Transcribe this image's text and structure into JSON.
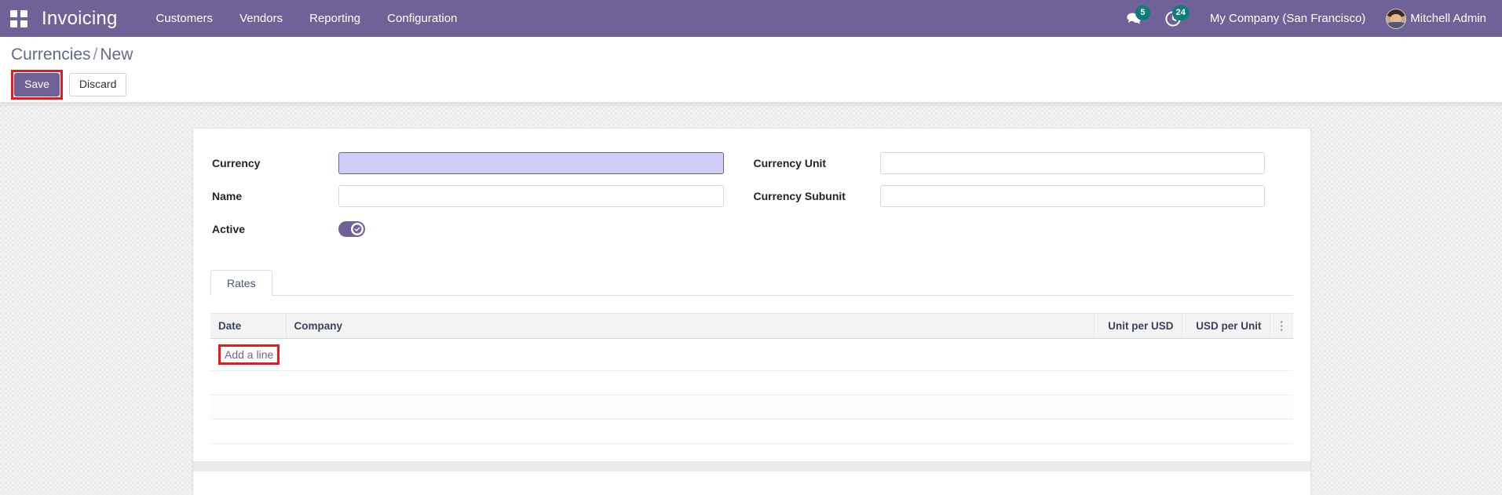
{
  "navbar": {
    "apps_icon": "apps-grid-icon",
    "brand": "Invoicing",
    "menu": [
      {
        "label": "Customers"
      },
      {
        "label": "Vendors"
      },
      {
        "label": "Reporting"
      },
      {
        "label": "Configuration"
      }
    ],
    "messages_icon": "messages-icon",
    "messages_count": "5",
    "activities_icon": "activity-clock-icon",
    "activities_count": "24",
    "company": "My Company (San Francisco)",
    "user": "Mitchell Admin",
    "colors": {
      "navbar_bg": "#6F6296",
      "badge_bg": "#0E7C7B",
      "accent": "#6F6296",
      "highlight": "#e81b1b"
    }
  },
  "control_panel": {
    "breadcrumb": {
      "parent": "Currencies",
      "separator": "/",
      "current": "New"
    },
    "save_label": "Save",
    "discard_label": "Discard"
  },
  "form": {
    "left": [
      {
        "label": "Currency",
        "value": "",
        "placeholder": "",
        "type": "text",
        "focused": true
      },
      {
        "label": "Name",
        "value": "",
        "placeholder": "",
        "type": "text",
        "focused": false
      },
      {
        "label": "Active",
        "value": "on",
        "type": "toggle",
        "focused": false
      }
    ],
    "right": [
      {
        "label": "Currency Unit",
        "value": "",
        "placeholder": "",
        "type": "text",
        "focused": false
      },
      {
        "label": "Currency Subunit",
        "value": "",
        "placeholder": "",
        "type": "text",
        "focused": false
      }
    ]
  },
  "notebook": {
    "tabs": [
      {
        "label": "Rates",
        "active": true
      }
    ]
  },
  "rates_table": {
    "columns": [
      "Date",
      "Company",
      "Unit per USD",
      "USD per Unit"
    ],
    "optional_columns_icon": "vertical-dots-icon",
    "rows": [],
    "add_line_label": "Add a line"
  }
}
